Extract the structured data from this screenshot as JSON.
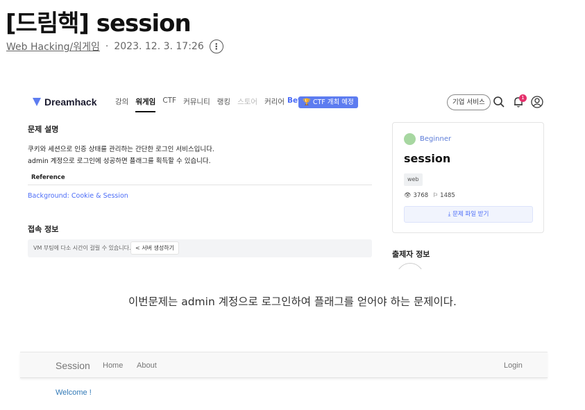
{
  "post": {
    "title": "[드림핵] session",
    "category": "Web Hacking/워게임",
    "separator": "·",
    "date": "2023. 12. 3. 17:26",
    "more_icon": "more-vertical-icon"
  },
  "dreamhack": {
    "logo": "Dreamhack",
    "menu": [
      "강의",
      "워게임",
      "CTF",
      "커뮤니티",
      "랭킹",
      "스토어",
      "커리어"
    ],
    "menu_beta": "Beta",
    "ctf_pill": "🏆 CTF 개최 예정",
    "biz_button": "기업 서비스",
    "notification_count": "1",
    "problem_heading": "문제 설명",
    "problem_lines": [
      "쿠키와 세션으로 인증 상태를 관리하는 간단한 로그인 서비스입니다.",
      "admin 계정으로 로그인에 성공하면 플래그를 획득할 수 있습니다."
    ],
    "reference_heading": "Reference",
    "reference_link": "Background: Cookie & Session",
    "connection_heading": "접속 정보",
    "connection_notice": "VM 부팅에 다소 시간이 걸릴 수 있습니다.",
    "connection_button": "< 서버 생성하기",
    "card": {
      "level": "Beginner",
      "title": "session",
      "tag": "web",
      "views": "3768",
      "solves": "1485",
      "download": "문제 파일 받기"
    },
    "author_heading": "출제자 정보"
  },
  "description": "이번문제는 admin 계정으로 로그인하여 플래그를 얻어야 하는 문제이다.",
  "session_app": {
    "brand": "Session",
    "nav": [
      "Home",
      "About"
    ],
    "login": "Login",
    "welcome": "Welcome !"
  }
}
